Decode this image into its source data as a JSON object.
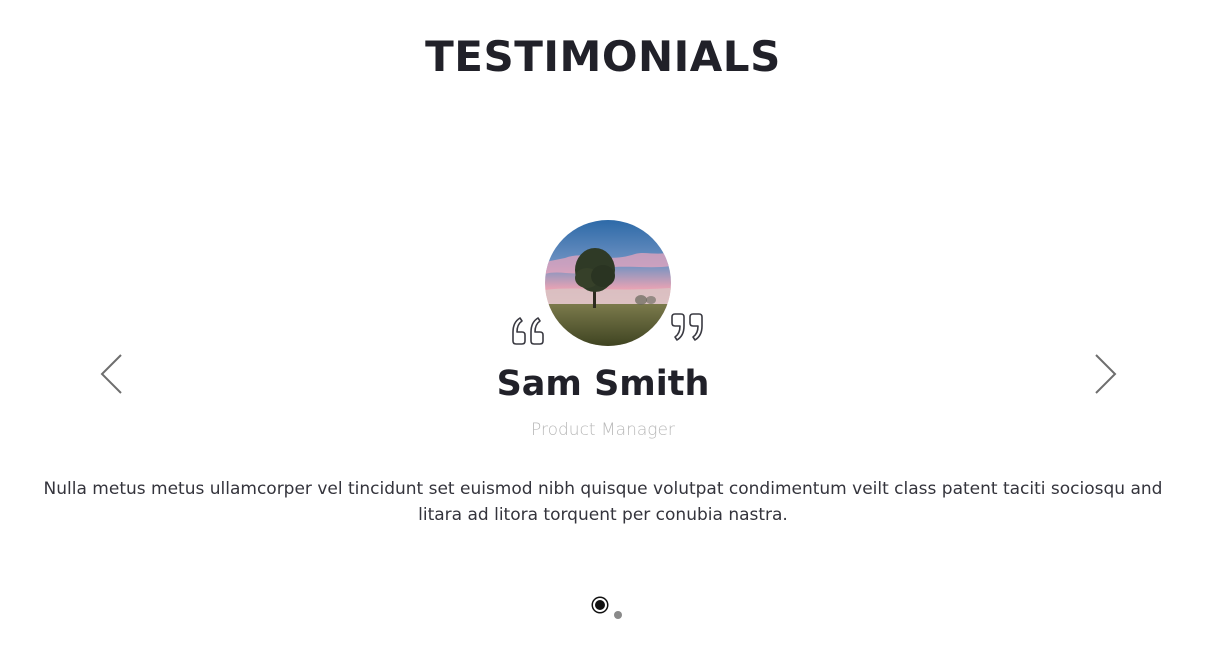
{
  "section": {
    "title": "TESTIMONIALS"
  },
  "carousel": {
    "prev_icon": "chevron-left-icon",
    "next_icon": "chevron-right-icon",
    "active_slide": 1,
    "slide_count": 2
  },
  "testimonial": {
    "avatar_icon": "tree-landscape-photo",
    "name": "Sam Smith",
    "role": "Product Manager",
    "text": "Nulla metus metus ullamcorper vel tincidunt set euismod nibh quisque volutpat condimentum veilt class patent taciti sociosqu and litara ad litora torquent per conubia nastra."
  },
  "colors": {
    "heading": "#212129",
    "role": "#b8b8b8",
    "body": "#34343c",
    "dot_active": "#111111",
    "dot_inactive": "#8a8a8a"
  }
}
